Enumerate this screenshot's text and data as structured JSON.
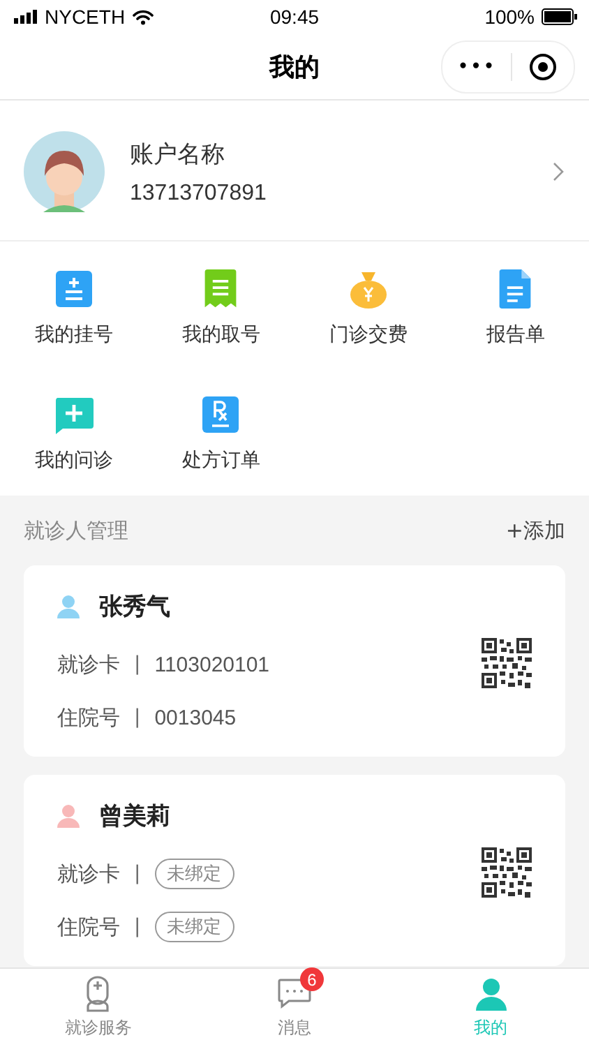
{
  "status_bar": {
    "carrier": "NYCETH",
    "time": "09:45",
    "battery": "100%"
  },
  "nav": {
    "title": "我的",
    "more": "•••"
  },
  "profile": {
    "name": "账户名称",
    "phone": "13713707891"
  },
  "menu": [
    {
      "label": "我的挂号",
      "kind": "register"
    },
    {
      "label": "我的取号",
      "kind": "ticket"
    },
    {
      "label": "门诊交费",
      "kind": "payment"
    },
    {
      "label": "报告单",
      "kind": "report"
    },
    {
      "label": "我的问诊",
      "kind": "consult"
    },
    {
      "label": "处方订单",
      "kind": "prescription"
    }
  ],
  "patients_section": {
    "title": "就诊人管理",
    "add": "+添加"
  },
  "patients": [
    {
      "name": "张秀气",
      "color": "#8fd3f4",
      "rows": [
        {
          "label": "就诊卡",
          "separator": "|",
          "kind": "value",
          "value": "1103020101"
        },
        {
          "label": "住院号",
          "separator": "|",
          "kind": "value",
          "value": "0013045"
        }
      ]
    },
    {
      "name": "曾美莉",
      "color": "#f8b8b8",
      "rows": [
        {
          "label": "就诊卡",
          "separator": "|",
          "kind": "unbound",
          "value": "未绑定"
        },
        {
          "label": "住院号",
          "separator": "|",
          "kind": "unbound",
          "value": "未绑定"
        }
      ]
    }
  ],
  "tab_bar": [
    {
      "label": "就诊服务",
      "kind": "service",
      "selected": false
    },
    {
      "label": "消息",
      "kind": "messages",
      "selected": false,
      "badge": "6"
    },
    {
      "label": "我的",
      "kind": "profile",
      "selected": true
    }
  ]
}
